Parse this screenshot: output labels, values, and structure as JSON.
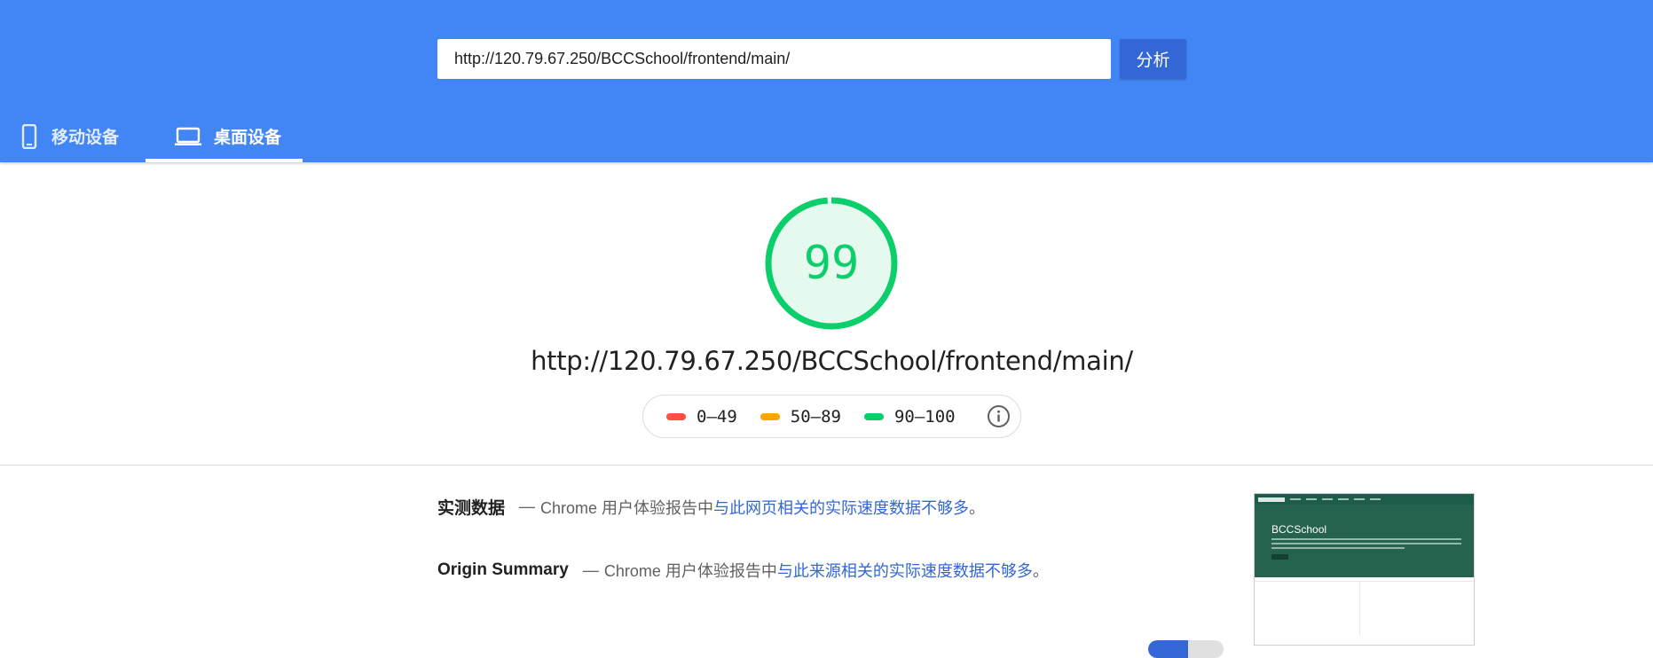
{
  "header": {
    "url_value": "http://120.79.67.250/BCCSchool/frontend/main/",
    "analyze_label": "分析",
    "tabs": [
      {
        "label": "移动设备",
        "icon": "smartphone-icon",
        "selected": false
      },
      {
        "label": "桌面设备",
        "icon": "laptop-icon",
        "selected": true
      }
    ]
  },
  "score": {
    "value": "99",
    "fraction": 0.99,
    "url": "http://120.79.67.250/BCCSchool/frontend/main/"
  },
  "legend": {
    "items": [
      {
        "label": "0–49",
        "color": "#ff4e42"
      },
      {
        "label": "50–89",
        "color": "#ffa400"
      },
      {
        "label": "90–100",
        "color": "#0cce6b"
      }
    ],
    "info_icon": "info-icon"
  },
  "field_data": {
    "title": "实测数据",
    "dash": "—",
    "source": "Chrome 用户体验报告中",
    "link": "与此网页相关的实际速度数据不够多",
    "end": "。"
  },
  "origin_summary": {
    "title": "Origin Summary",
    "dash": "—",
    "source": "Chrome 用户体验报告中",
    "link": "与此来源相关的实际速度数据不够多",
    "end": "。"
  },
  "thumbnail": {
    "hero_title": "BCCSchool"
  },
  "colors": {
    "header_bg": "#4285f4",
    "button_bg": "#3367d6",
    "pass_green": "#0cce6b",
    "link_blue": "#3367d6"
  }
}
